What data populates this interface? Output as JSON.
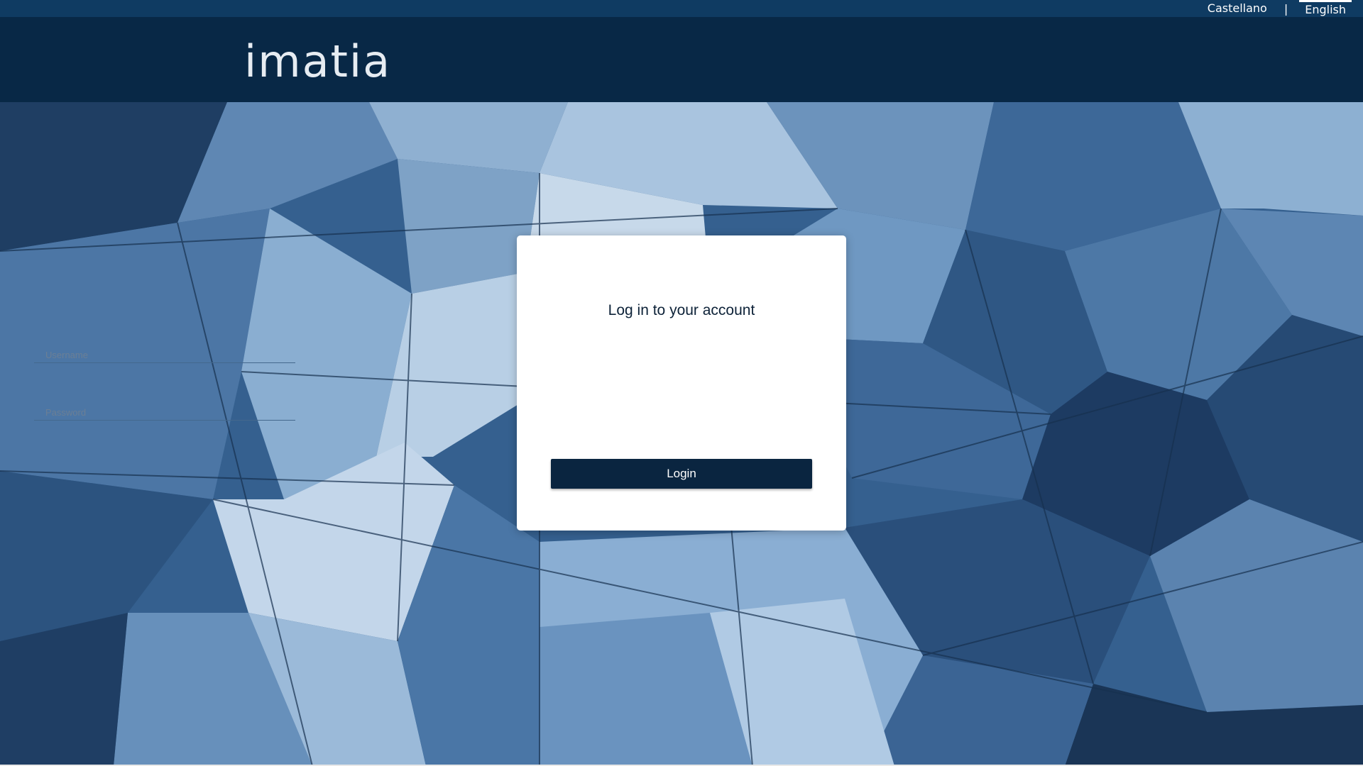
{
  "language_switcher": {
    "option_spanish": "Castellano",
    "separator": "|",
    "option_english": "English",
    "active": "English"
  },
  "header": {
    "logo_text": "imatia"
  },
  "login_form": {
    "title": "Log in to your account",
    "username_placeholder": "Username",
    "password_placeholder": "Password",
    "submit_label": "Login"
  },
  "colors": {
    "top_bar": "#0f3b62",
    "header": "#082846",
    "button": "#0a2540",
    "background_tint": "#3e6a9c"
  }
}
